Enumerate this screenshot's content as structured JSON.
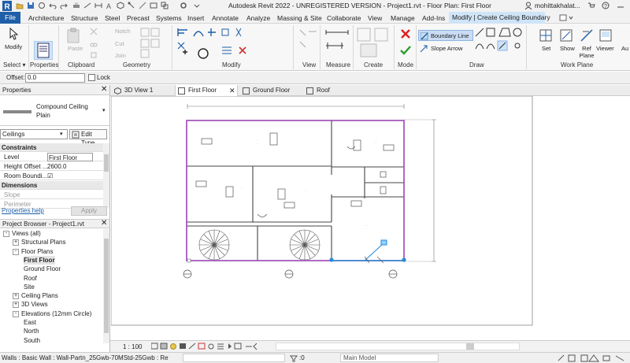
{
  "app": {
    "title": "Autodesk Revit 2022 - UNREGISTERED VERSION - Project1.rvt - Floor Plan: First Floor",
    "user": "mohittakhalat..."
  },
  "tabs": [
    "File",
    "Architecture",
    "Structure",
    "Steel",
    "Precast",
    "Systems",
    "Insert",
    "Annotate",
    "Analyze",
    "Massing & Site",
    "Collaborate",
    "View",
    "Manage",
    "Add-Ins",
    "Modify | Create Ceiling Boundary"
  ],
  "ribbon": {
    "panels": [
      "Select",
      "Properties",
      "Clipboard",
      "Geometry",
      "Modify",
      "View",
      "Measure",
      "Create",
      "Mode",
      "Draw",
      "Work Plane"
    ],
    "select_label": "Select ▾",
    "modify_label": "Modify",
    "properties_label": "Properties",
    "paste_label": "Paste",
    "clipboard_items": [
      "Cut",
      "Join"
    ],
    "notch_label": "Notch",
    "boundary_line": "Boundary Line",
    "slope_arrow": "Slope Arrow",
    "set_label": "Set",
    "show_label": "Show",
    "ref_plane_label": "Ref Plane",
    "viewer_label": "Viewer",
    "au_label": "Au"
  },
  "options": {
    "offset_label": "Offset:",
    "offset_value": "0.0",
    "lock_label": "Lock"
  },
  "properties": {
    "header": "Properties",
    "type_name": "Compound Ceiling Plain",
    "category": "Ceilings",
    "edit_type": "Edit Type",
    "groups": [
      "Constraints",
      "Dimensions"
    ],
    "rows": [
      {
        "label": "Level",
        "value": "First Floor"
      },
      {
        "label": "Height Offset ...",
        "value": "2600.0"
      },
      {
        "label": "Room Boundi...",
        "value": "☑"
      },
      {
        "label": "Slope",
        "value": ""
      },
      {
        "label": "Perimeter",
        "value": ""
      }
    ],
    "help": "Properties help",
    "apply": "Apply"
  },
  "browser": {
    "header": "Project Browser - Project1.rvt",
    "items": [
      {
        "label": "Views (all)",
        "indent": 0,
        "toggle": "-"
      },
      {
        "label": "Structural Plans",
        "indent": 1,
        "toggle": "+"
      },
      {
        "label": "Floor Plans",
        "indent": 1,
        "toggle": "-"
      },
      {
        "label": "First Floor",
        "indent": 2,
        "toggle": "",
        "bold": true
      },
      {
        "label": "Ground Floor",
        "indent": 2,
        "toggle": ""
      },
      {
        "label": "Roof",
        "indent": 2,
        "toggle": ""
      },
      {
        "label": "Site",
        "indent": 2,
        "toggle": ""
      },
      {
        "label": "Ceiling Plans",
        "indent": 1,
        "toggle": "+"
      },
      {
        "label": "3D Views",
        "indent": 1,
        "toggle": "+"
      },
      {
        "label": "Elevations (12mm Circle)",
        "indent": 1,
        "toggle": "-"
      },
      {
        "label": "East",
        "indent": 2,
        "toggle": ""
      },
      {
        "label": "North",
        "indent": 2,
        "toggle": ""
      },
      {
        "label": "South",
        "indent": 2,
        "toggle": ""
      }
    ]
  },
  "view_tabs": [
    {
      "label": "3D View 1",
      "active": false,
      "close": false
    },
    {
      "label": "First Floor",
      "active": true,
      "close": true
    },
    {
      "label": "Ground Floor",
      "active": false,
      "close": false
    },
    {
      "label": "Roof",
      "active": false,
      "close": false
    }
  ],
  "view_control": {
    "scale": "1 : 100"
  },
  "status": {
    "text": "Walls : Basic Wall : Wall-Partn_25Gwb-70MStd-25Gwb : Referen",
    "count": ":0",
    "model": "Main Model"
  },
  "colors": {
    "accent_tab": "#cfe4f7",
    "file_tab": "#1f5fa8",
    "boundary": "#9c3fb5",
    "selection": "#2a8ad4"
  }
}
